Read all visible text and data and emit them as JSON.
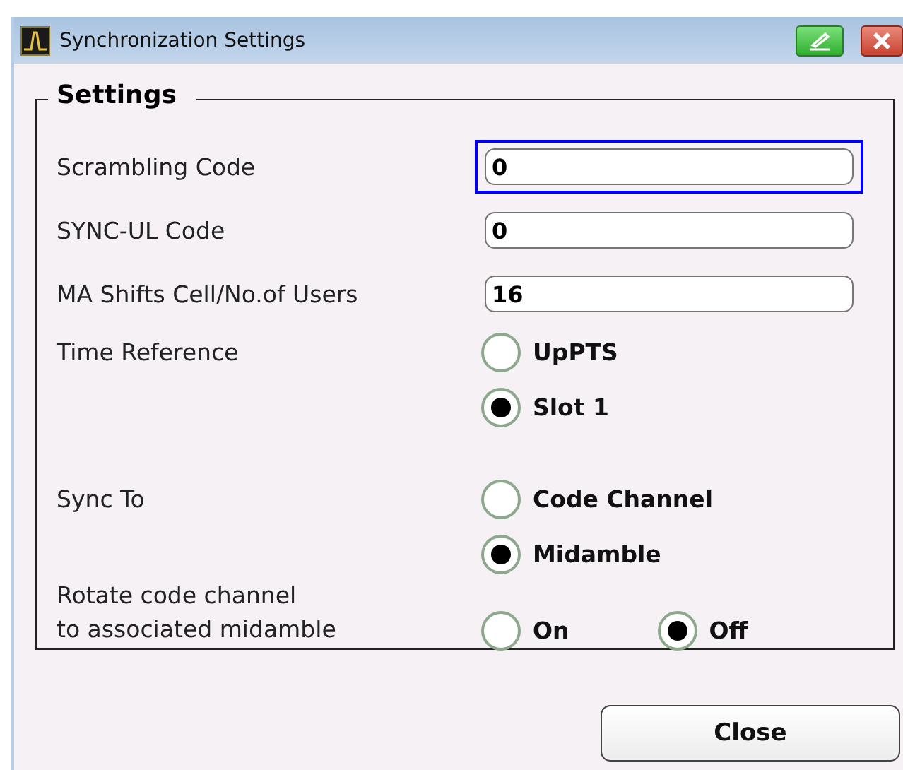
{
  "window": {
    "title": "Synchronization Settings"
  },
  "group": {
    "title": "Settings"
  },
  "rows": [
    {
      "kind": "field",
      "label": "Scrambling Code",
      "value": "0",
      "focused": true
    },
    {
      "kind": "field",
      "label": "SYNC-UL Code",
      "value": "0",
      "focused": false
    },
    {
      "kind": "field",
      "label": "MA Shifts Cell/No.of Users",
      "value": "16",
      "focused": false
    },
    {
      "kind": "radio-column",
      "label": "Time Reference",
      "options": [
        {
          "label": "UpPTS",
          "selected": false
        },
        {
          "label": "Slot 1",
          "selected": true
        }
      ]
    },
    {
      "kind": "radio-column",
      "label": "Sync To",
      "options": [
        {
          "label": "Code Channel",
          "selected": false
        },
        {
          "label": "Midamble",
          "selected": true
        }
      ]
    },
    {
      "kind": "radio-row",
      "label": "Rotate code channel\nto associated midamble",
      "options": [
        {
          "label": "On",
          "selected": false
        },
        {
          "label": "Off",
          "selected": true
        }
      ]
    }
  ],
  "buttons": [
    {
      "label": "Close"
    }
  ]
}
